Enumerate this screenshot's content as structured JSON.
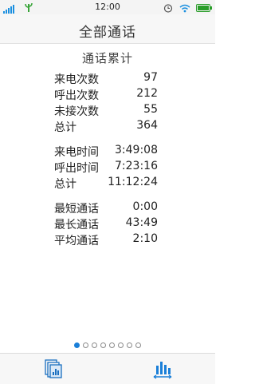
{
  "status_bar": {
    "time": "12:00"
  },
  "header": {
    "title": "全部通话"
  },
  "section_title": "通话累计",
  "counts": [
    {
      "label": "来电次数",
      "value": "97"
    },
    {
      "label": "呼出次数",
      "value": "212"
    },
    {
      "label": "未接次数",
      "value": "55"
    },
    {
      "label": "总计",
      "value": "364"
    }
  ],
  "durations": [
    {
      "label": "来电时间",
      "value": "3:49:08"
    },
    {
      "label": "呼出时间",
      "value": "7:23:16"
    },
    {
      "label": "总计",
      "value": "11:12:24"
    }
  ],
  "call_stats": [
    {
      "label": "最短通话",
      "value": "0:00"
    },
    {
      "label": "最长通话",
      "value": "43:49"
    },
    {
      "label": "平均通话",
      "value": "2:10"
    }
  ],
  "pager": {
    "count": 8,
    "active_index": 0
  },
  "tabs": [
    {
      "icon": "call-log-pages-icon"
    },
    {
      "icon": "statistics-bar-chart-icon"
    }
  ],
  "colors": {
    "accent": "#1a7fd8"
  }
}
